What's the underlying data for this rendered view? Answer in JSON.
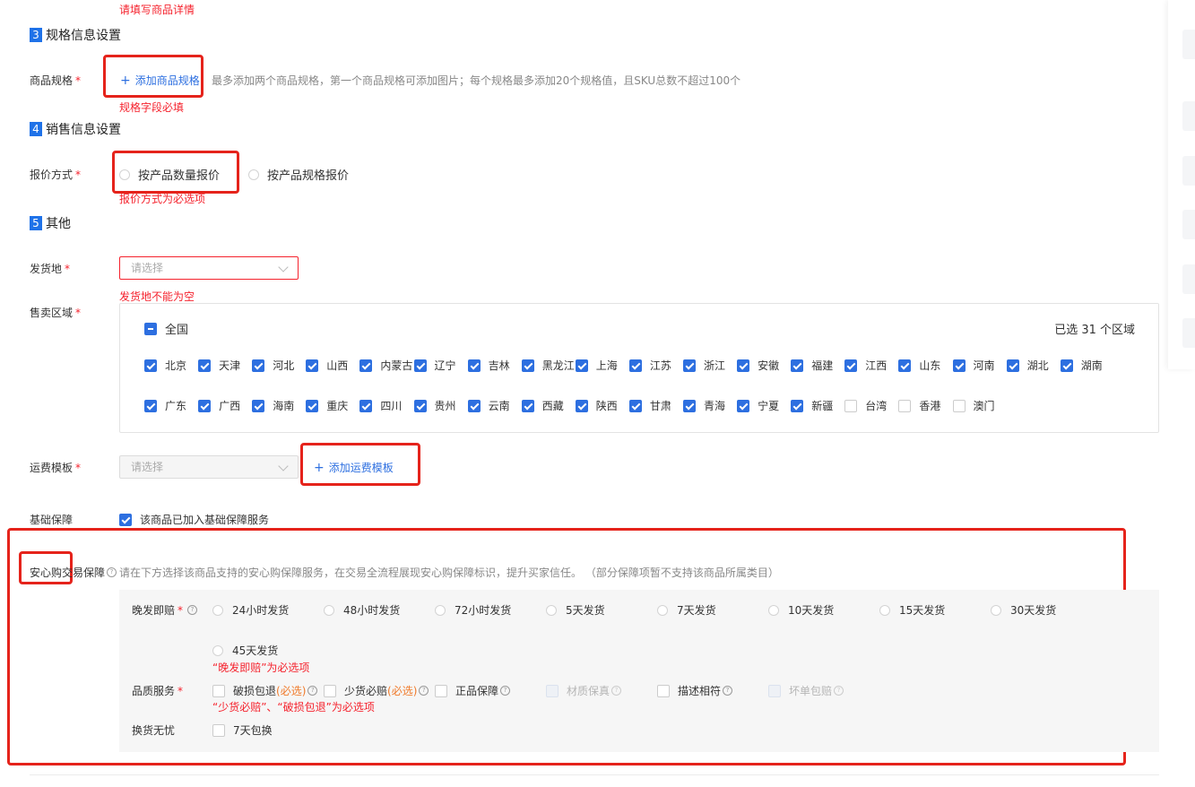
{
  "top_error": "请填写商品详情",
  "sections": {
    "spec": {
      "num": "3",
      "title": "规格信息设置"
    },
    "sale": {
      "num": "4",
      "title": "销售信息设置"
    },
    "other": {
      "num": "5",
      "title": "其他"
    }
  },
  "spec": {
    "label": "商品规格",
    "add_label": "添加商品规格",
    "hint": "最多添加两个商品规格，第一个商品规格可添加图片；每个规格最多添加20个规格值，且SKU总数不超过100个",
    "error": "规格字段必填"
  },
  "pricing": {
    "label": "报价方式",
    "options": [
      "按产品数量报价",
      "按产品规格报价"
    ],
    "error": "报价方式为必选项"
  },
  "ship_from": {
    "label": "发货地",
    "placeholder": "请选择",
    "error": "发货地不能为空"
  },
  "sale_area": {
    "label": "售卖区域",
    "all_label": "全国",
    "selected_text": "已选 31 个区域",
    "row1": [
      {
        "name": "北京",
        "checked": true
      },
      {
        "name": "天津",
        "checked": true
      },
      {
        "name": "河北",
        "checked": true
      },
      {
        "name": "山西",
        "checked": true
      },
      {
        "name": "内蒙古",
        "checked": true
      },
      {
        "name": "辽宁",
        "checked": true
      },
      {
        "name": "吉林",
        "checked": true
      },
      {
        "name": "黑龙江",
        "checked": true
      },
      {
        "name": "上海",
        "checked": true
      },
      {
        "name": "江苏",
        "checked": true
      },
      {
        "name": "浙江",
        "checked": true
      },
      {
        "name": "安徽",
        "checked": true
      },
      {
        "name": "福建",
        "checked": true
      },
      {
        "name": "江西",
        "checked": true
      },
      {
        "name": "山东",
        "checked": true
      },
      {
        "name": "河南",
        "checked": true
      },
      {
        "name": "湖北",
        "checked": true
      },
      {
        "name": "湖南",
        "checked": true
      }
    ],
    "row2": [
      {
        "name": "广东",
        "checked": true
      },
      {
        "name": "广西",
        "checked": true
      },
      {
        "name": "海南",
        "checked": true
      },
      {
        "name": "重庆",
        "checked": true
      },
      {
        "name": "四川",
        "checked": true
      },
      {
        "name": "贵州",
        "checked": true
      },
      {
        "name": "云南",
        "checked": true
      },
      {
        "name": "西藏",
        "checked": true
      },
      {
        "name": "陕西",
        "checked": true
      },
      {
        "name": "甘肃",
        "checked": true
      },
      {
        "name": "青海",
        "checked": true
      },
      {
        "name": "宁夏",
        "checked": true
      },
      {
        "name": "新疆",
        "checked": true
      },
      {
        "name": "台湾",
        "checked": false
      },
      {
        "name": "香港",
        "checked": false
      },
      {
        "name": "澳门",
        "checked": false
      }
    ]
  },
  "freight": {
    "label": "运费模板",
    "placeholder": "请选择",
    "add_label": "添加运费模板"
  },
  "basic_guarantee": {
    "label": "基础保障",
    "checkbox_label": "该商品已加入基础保障服务"
  },
  "assurance": {
    "label": "安心购交易保障",
    "hint": "请在下方选择该商品支持的安心购保障服务，在交易全流程展现安心购保障标识，提升买家信任。 （部分保障项暂不支持该商品所属类目）",
    "late_ship": {
      "label": "晚发即赔",
      "options": [
        "24小时发货",
        "48小时发货",
        "72小时发货",
        "5天发货",
        "7天发货",
        "10天发货",
        "15天发货",
        "30天发货",
        "45天发货"
      ],
      "error": "“晚发即赔”为必选项"
    },
    "quality": {
      "label": "品质服务",
      "items": [
        {
          "label": "破损包退",
          "suffix": "(必选)",
          "disabled": false
        },
        {
          "label": "少货必赔",
          "suffix": "(必选)",
          "disabled": false
        },
        {
          "label": "正品保障",
          "suffix": "",
          "disabled": false
        },
        {
          "label": "材质保真",
          "suffix": "",
          "disabled": true
        },
        {
          "label": "描述相符",
          "suffix": "",
          "disabled": false
        },
        {
          "label": "坏单包赔",
          "suffix": "",
          "disabled": true
        }
      ],
      "error": "“少货必赔”、“破损包退”为必选项"
    },
    "exchange": {
      "label": "换货无忧",
      "option": "7天包换"
    }
  },
  "colors": {
    "accent": "#2d6fe0",
    "error": "#f5222d",
    "highlight_box": "#e5231b"
  }
}
